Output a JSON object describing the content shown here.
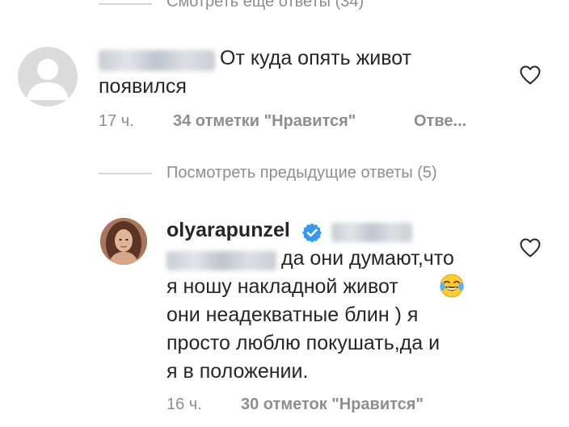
{
  "top_thread": {
    "view_more_label": "Смотреть еще ответы (34)"
  },
  "comment_1": {
    "username": "",
    "text_line_1": "От куда опять живот",
    "text_line_2": "появился",
    "time": "17 ч.",
    "likes": "34 отметки \"Нравится\"",
    "reply": "Отве..."
  },
  "reply_thread": {
    "view_previous_label": "Посмотреть предыдущие ответы (5)"
  },
  "comment_2": {
    "username": "olyarapunzel",
    "line_1": "да они думают,что",
    "line_2": "я ношу накладной живот",
    "line_3": "они неадекватные блин ) я",
    "line_4": "просто люблю покушать,да и",
    "line_5": "я в положении.",
    "time": "16 ч.",
    "likes": "30 отметок \"Нравится\""
  },
  "icons": {
    "heart": "heart-outline-icon",
    "verified": "verified-badge-icon",
    "emoji": "tears-of-joy-emoji",
    "avatar_default": "default-avatar-icon"
  },
  "colors": {
    "text": "#262626",
    "secondary": "#8e8e8e",
    "divider": "#d6d6d6",
    "verified": "#3897f0"
  }
}
